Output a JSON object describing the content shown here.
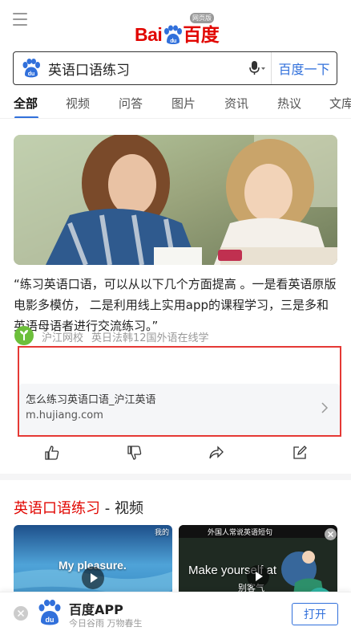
{
  "header": {
    "logo_text_left": "Bai",
    "logo_text_right": "百度",
    "logo_badge": "网页版"
  },
  "search": {
    "query": "英语口语练习",
    "button_label": "百度一下"
  },
  "tabs": [
    {
      "label": "全部",
      "active": true
    },
    {
      "label": "视频",
      "active": false
    },
    {
      "label": "问答",
      "active": false
    },
    {
      "label": "图片",
      "active": false
    },
    {
      "label": "资讯",
      "active": false
    },
    {
      "label": "热议",
      "active": false
    },
    {
      "label": "文库",
      "active": false
    }
  ],
  "result": {
    "quote": "“练习英语口语，可以从以下几个方面提高 。一是看英语原版电影多模仿， 二是利用线上实用app的课程学习，三是多和英语母语者进行交流练习。”",
    "source_name": "沪江网校",
    "source_desc": "英日法韩12国外语在线学",
    "link_title": "怎么练习英语口语_沪江英语",
    "link_url": "m.hujiang.com"
  },
  "video_section": {
    "title_highlight": "英语口语练习",
    "title_suffix": " - 视频",
    "videos": [
      {
        "caption": "My pleasure.",
        "corner_text": "我的"
      },
      {
        "caption": "Make yourself at",
        "caption_cn": "别客气",
        "top_text": "外国人常说英语短句"
      }
    ]
  },
  "app_banner": {
    "name": "百度APP",
    "slogan": "今日谷雨 万物春生",
    "open_label": "打开"
  },
  "colors": {
    "brand_red": "#e10601",
    "brand_blue": "#3170db",
    "highlight_box": "#e53935"
  }
}
